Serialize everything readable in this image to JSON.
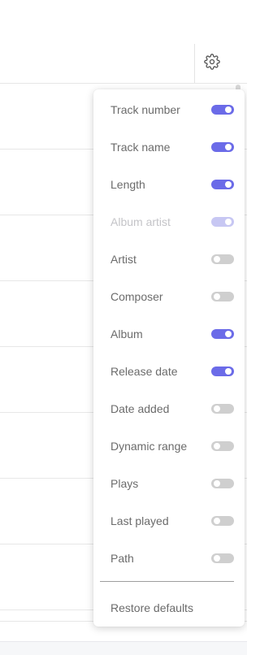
{
  "header": {
    "settings_icon": "gear-icon"
  },
  "column_menu": {
    "items": [
      {
        "label": "Track number",
        "enabled": true,
        "disabled": false
      },
      {
        "label": "Track name",
        "enabled": true,
        "disabled": false
      },
      {
        "label": "Length",
        "enabled": true,
        "disabled": false
      },
      {
        "label": "Album artist",
        "enabled": true,
        "disabled": true
      },
      {
        "label": "Artist",
        "enabled": false,
        "disabled": false
      },
      {
        "label": "Composer",
        "enabled": false,
        "disabled": false
      },
      {
        "label": "Album",
        "enabled": true,
        "disabled": false
      },
      {
        "label": "Release date",
        "enabled": true,
        "disabled": false
      },
      {
        "label": "Date added",
        "enabled": false,
        "disabled": false
      },
      {
        "label": "Dynamic range",
        "enabled": false,
        "disabled": false
      },
      {
        "label": "Plays",
        "enabled": false,
        "disabled": false
      },
      {
        "label": "Last played",
        "enabled": false,
        "disabled": false
      },
      {
        "label": "Path",
        "enabled": false,
        "disabled": false
      }
    ],
    "restore_label": "Restore defaults"
  },
  "colors": {
    "accent": "#6b6be8",
    "toggle_off": "#cfcfcf",
    "text": "#6b6b6b",
    "disabled_text": "#c4c4c8"
  }
}
